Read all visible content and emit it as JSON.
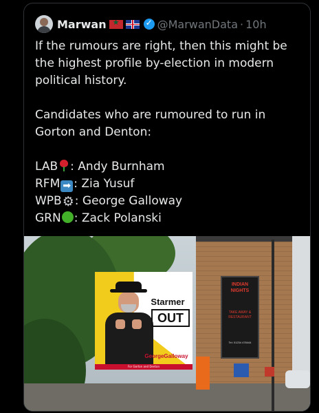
{
  "tweet": {
    "author_name": "Marwan",
    "handle": "@MarwanData",
    "separator": "·",
    "time": "10h",
    "flags": [
      "morocco-flag-icon",
      "uk-flag-icon"
    ],
    "verified_icon": "verified-badge-icon",
    "paragraph1": "If the rumours are right, then this might be the highest profile by-election in modern political history.",
    "paragraph2": "Candidates who are rumoured to run in Gorton and Denton:",
    "candidates": [
      {
        "party": "LAB",
        "icon": "rose-icon",
        "text": ": Andy Burnham"
      },
      {
        "party": "RFM",
        "icon": "right-arrow-icon",
        "text": ": Zia Yusuf"
      },
      {
        "party": "WPB",
        "icon": "gear-icon",
        "text": ": George Galloway"
      },
      {
        "party": "GRN",
        "icon": "green-circle-icon",
        "text": ": Zack Polanski"
      }
    ]
  },
  "image": {
    "poster_line1": "Starmer",
    "poster_line2": "OUT",
    "poster_brand": "GeorgeGalloway",
    "poster_tagline": "For Gorton and Denton",
    "sign_name": "INDIAN NIGHTS",
    "sign_services": "TAKE AWAY & RESTAURANT",
    "sign_phone": "Tel: 01234 478444"
  },
  "colors": {
    "background": "#000000",
    "text": "#e7e9ea",
    "muted": "#71767b",
    "verified": "#1d9bf0",
    "poster_yellow": "#f2cc1d"
  }
}
